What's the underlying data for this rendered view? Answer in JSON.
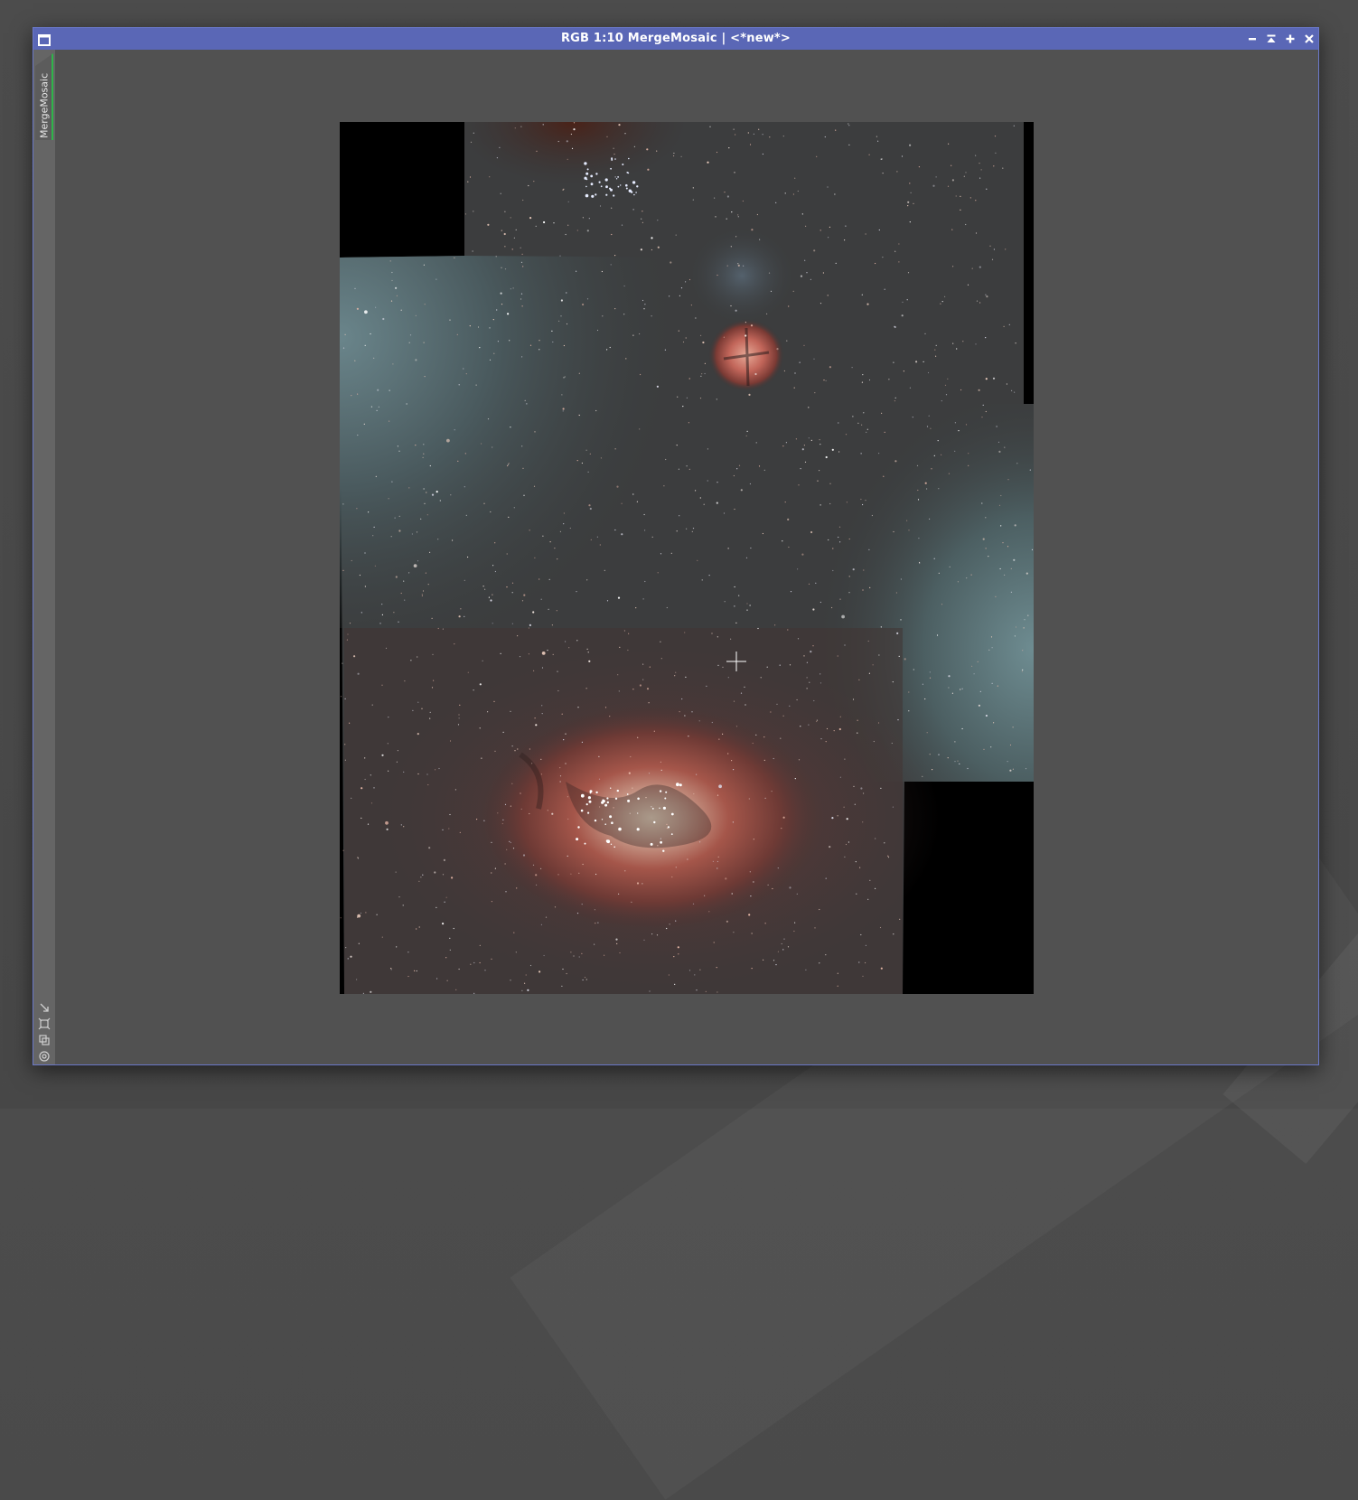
{
  "window": {
    "title": "RGB 1:10 MergeMosaic | <*new*>",
    "accent_color": "#5a67b6",
    "border_color": "#6a78c8",
    "buttons": [
      {
        "name": "minimize",
        "icon": "minimize-icon"
      },
      {
        "name": "shade",
        "icon": "shade-icon"
      },
      {
        "name": "maximize",
        "icon": "maximize-icon"
      },
      {
        "name": "close",
        "icon": "close-icon"
      }
    ]
  },
  "side_panel": {
    "tab_label": "MergeMosaic",
    "tab_indicator_color": "#2fb44a",
    "tools": [
      "fit-view-icon",
      "zoom-to-fit-icon",
      "clone-icon",
      "target-icon"
    ]
  },
  "image": {
    "description_objects": [
      "trifid-nebula",
      "lagoon-nebula",
      "star-field",
      "black-mosaic-gaps"
    ],
    "colors": {
      "sky": "#3a3d3e",
      "teal_gradient": "#5f7a80",
      "nebula_red": "#b15a4e",
      "nebula_core": "#e8d4bc"
    }
  }
}
